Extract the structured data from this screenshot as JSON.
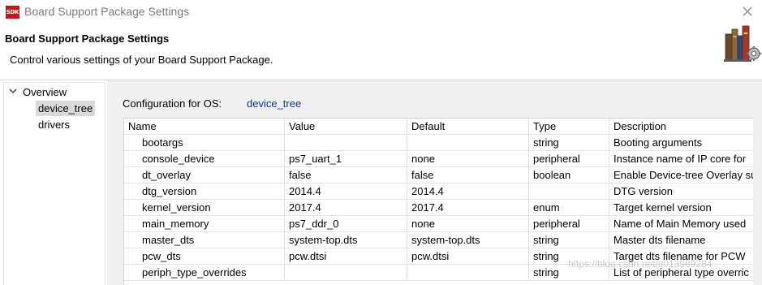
{
  "window": {
    "icon_text": "SDK",
    "title": "Board Support Package Settings"
  },
  "header": {
    "title": "Board Support Package Settings",
    "description": "Control various settings of your Board Support Package."
  },
  "nav": {
    "root_label": "Overview",
    "items": [
      {
        "label": "device_tree",
        "selected": true
      },
      {
        "label": "drivers",
        "selected": false
      }
    ]
  },
  "config": {
    "label": "Configuration for OS:",
    "value": "device_tree"
  },
  "table": {
    "columns": [
      "Name",
      "Value",
      "Default",
      "Type",
      "Description"
    ],
    "rows": [
      [
        "bootargs",
        "",
        "",
        "string",
        "Booting arguments"
      ],
      [
        "console_device",
        "ps7_uart_1",
        "none",
        "peripheral",
        "Instance name of IP core for"
      ],
      [
        "dt_overlay",
        "false",
        "false",
        "boolean",
        "Enable Device-tree Overlay su"
      ],
      [
        "dtg_version",
        "2014.4",
        "2014.4",
        "",
        "DTG version"
      ],
      [
        "kernel_version",
        "2017.4",
        "2017.4",
        "enum",
        "Target kernel version"
      ],
      [
        "main_memory",
        "ps7_ddr_0",
        "none",
        "peripheral",
        "Name of Main Memory used"
      ],
      [
        "master_dts",
        "system-top.dts",
        "system-top.dts",
        "string",
        "Master dts filename"
      ],
      [
        "pcw_dts",
        "pcw.dtsi",
        "pcw.dtsi",
        "string",
        "Target dts filename for PCW"
      ],
      [
        "periph_type_overrides",
        "",
        "",
        "string",
        "List of peripheral type overric"
      ]
    ]
  },
  "watermark": "https://blog.csdn.net/u013989284",
  "colors": {
    "link_blue": "#0a34a6",
    "selection_gray": "#d9d9d9",
    "panel_gray": "#f0f0f0",
    "icon_red": "#c8141e"
  }
}
